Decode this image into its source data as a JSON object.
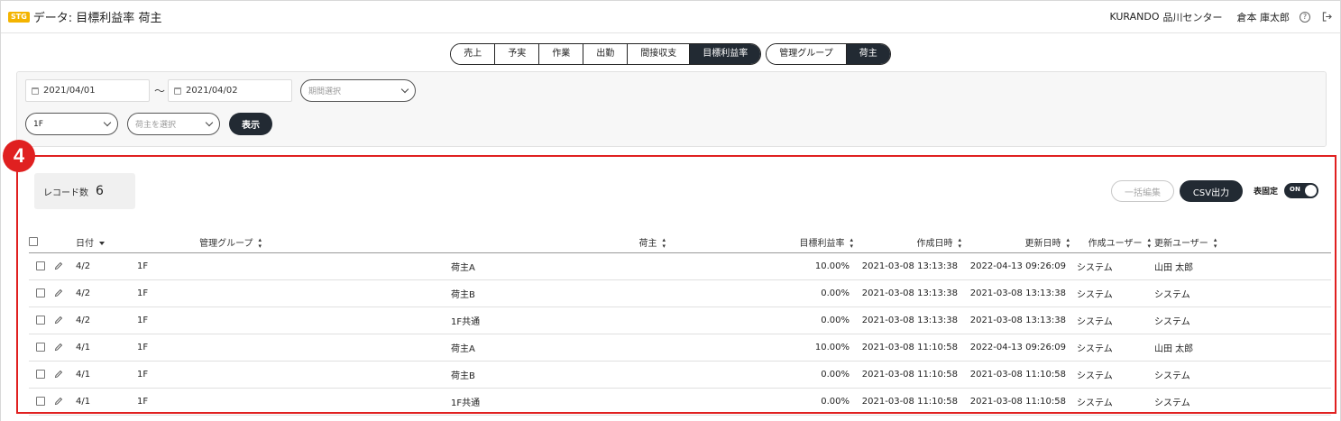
{
  "header": {
    "badge": "STG",
    "title": "データ: 目標利益率 荷主",
    "company": "KURANDO",
    "center": "品川センター",
    "user": "倉本 庫太郎",
    "help_icon": "help-circle-icon",
    "logout_icon": "logout-icon"
  },
  "tabs": {
    "group1": [
      "売上",
      "予実",
      "作業",
      "出勤",
      "間接収支",
      "目標利益率"
    ],
    "group2": [
      "管理グループ",
      "荷主"
    ],
    "active_group1": "目標利益率",
    "active_group2": "荷主"
  },
  "filters": {
    "date_from": "2021/04/01",
    "tilde": "～",
    "date_to": "2021/04/02",
    "period_placeholder": "期間選択",
    "floor": "1F",
    "shipper_placeholder": "荷主を選択",
    "display_label": "表示"
  },
  "annotation": {
    "step": "4"
  },
  "records": {
    "label": "レコード数",
    "count": "6"
  },
  "toolbar": {
    "bulk_edit": "一括編集",
    "csv": "CSV出力",
    "fix_label": "表固定",
    "toggle_text": "ON"
  },
  "table": {
    "headers": {
      "date": "日付",
      "group": "管理グループ",
      "shipper": "荷主",
      "rate": "目標利益率",
      "created": "作成日時",
      "updated": "更新日時",
      "created_by": "作成ユーザー",
      "updated_by": "更新ユーザー"
    },
    "rows": [
      {
        "date": "4/2",
        "group": "1F",
        "shipper": "荷主A",
        "rate": "10.00%",
        "created": "2021-03-08 13:13:38",
        "updated": "2022-04-13 09:26:09",
        "created_by": "システム",
        "updated_by": "山田 太郎"
      },
      {
        "date": "4/2",
        "group": "1F",
        "shipper": "荷主B",
        "rate": "0.00%",
        "created": "2021-03-08 13:13:38",
        "updated": "2021-03-08 13:13:38",
        "created_by": "システム",
        "updated_by": "システム"
      },
      {
        "date": "4/2",
        "group": "1F",
        "shipper": "1F共通",
        "rate": "0.00%",
        "created": "2021-03-08 13:13:38",
        "updated": "2021-03-08 13:13:38",
        "created_by": "システム",
        "updated_by": "システム"
      },
      {
        "date": "4/1",
        "group": "1F",
        "shipper": "荷主A",
        "rate": "10.00%",
        "created": "2021-03-08 11:10:58",
        "updated": "2022-04-13 09:26:09",
        "created_by": "システム",
        "updated_by": "山田 太郎"
      },
      {
        "date": "4/1",
        "group": "1F",
        "shipper": "荷主B",
        "rate": "0.00%",
        "created": "2021-03-08 11:10:58",
        "updated": "2021-03-08 11:10:58",
        "created_by": "システム",
        "updated_by": "システム"
      },
      {
        "date": "4/1",
        "group": "1F",
        "shipper": "1F共通",
        "rate": "0.00%",
        "created": "2021-03-08 11:10:58",
        "updated": "2021-03-08 11:10:58",
        "created_by": "システム",
        "updated_by": "システム"
      }
    ]
  },
  "colors": {
    "accent": "#222a33",
    "annotation": "#e02020",
    "badge": "#f4b400"
  }
}
